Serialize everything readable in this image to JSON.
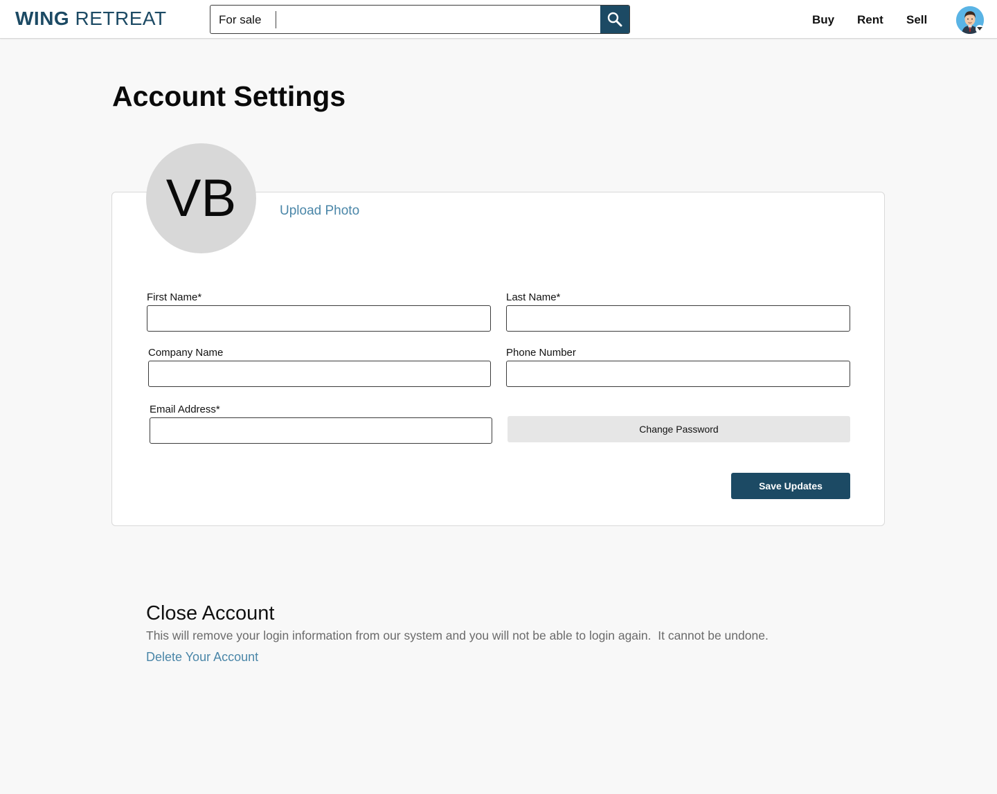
{
  "header": {
    "logo_bold": "WING",
    "logo_light": "RETREAT",
    "search_type": "For sale",
    "search_value": "",
    "nav": [
      "Buy",
      "Rent",
      "Sell"
    ]
  },
  "page": {
    "title": "Account Settings"
  },
  "profile": {
    "initials": "VB",
    "upload_label": "Upload Photo"
  },
  "form": {
    "first_name_label": "First Name*",
    "last_name_label": "Last Name*",
    "company_label": "Company Name",
    "phone_label": "Phone Number",
    "email_label": "Email Address*",
    "first_name_value": "",
    "last_name_value": "",
    "company_value": "",
    "phone_value": "",
    "email_value": "",
    "change_password_label": "Change Password",
    "save_label": "Save Updates"
  },
  "close_account": {
    "title": "Close Account",
    "description": "This will remove your login information from our system and you will not be able to login again.  It cannot be undone.",
    "delete_label": "Delete Your Account"
  },
  "colors": {
    "brand": "#1c4a64",
    "link": "#4a86a8",
    "background": "#f8f8f8"
  },
  "icons": {
    "search": "search-icon",
    "avatar": "user-avatar",
    "caret": "chevron-down-icon"
  }
}
